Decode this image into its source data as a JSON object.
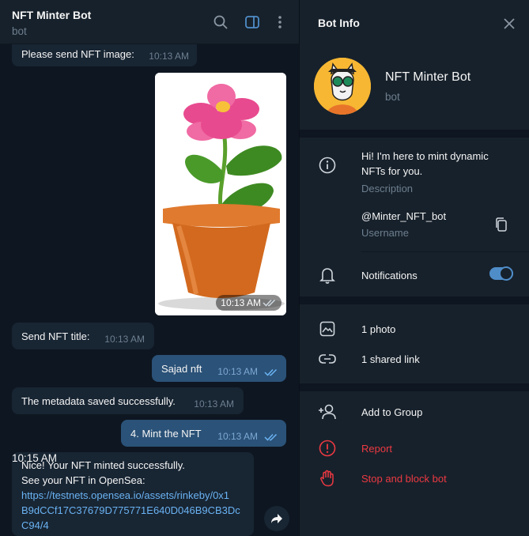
{
  "chat": {
    "title": "NFT Minter Bot",
    "subtitle": "bot",
    "header_icons": [
      "search-icon",
      "sidebar-toggle-icon",
      "more-vertical-icon"
    ],
    "messages": [
      {
        "dir": "in",
        "text": "Please send NFT image:",
        "time": "10:13 AM"
      },
      {
        "dir": "in",
        "kind": "photo",
        "time": "10:13 AM",
        "read": true
      },
      {
        "dir": "in",
        "text": "Send NFT title:",
        "time": "10:13 AM"
      },
      {
        "dir": "out",
        "text": "Sajad nft",
        "time": "10:13 AM",
        "read": true
      },
      {
        "dir": "in",
        "text": "The metadata saved successfully.",
        "time": "10:13 AM"
      },
      {
        "dir": "out",
        "text": "4. Mint the NFT",
        "time": "10:13 AM",
        "read": true
      },
      {
        "dir": "in",
        "line1": "Nice! Your NFT minted successfully.",
        "line2": "See your NFT in OpenSea:",
        "link_lines": [
          "https://testnets.opensea.io/assets/rinkeby/0x1",
          "B9dCCf17C37679D775771E640D046B9CB3Dc",
          "C94/4"
        ],
        "time": "10:15 AM"
      }
    ]
  },
  "info": {
    "title": "Bot Info",
    "bot_name": "NFT Minter Bot",
    "bot_sub": "bot",
    "description_lines": [
      "Hi! I'm here to mint dynamic",
      "NFTs for you."
    ],
    "description_label": "Description",
    "username": "@Minter_NFT_bot",
    "username_label": "Username",
    "notifications_label": "Notifications",
    "notifications_on": true,
    "photos": "1 photo",
    "links": "1 shared link",
    "add_to_group": "Add to Group",
    "report": "Report",
    "stop_block": "Stop and block bot"
  },
  "colors": {
    "accent": "#4f8dc9",
    "danger": "#ec3942",
    "outgoing_bubble": "#2b5278",
    "incoming_bubble": "#182533"
  }
}
